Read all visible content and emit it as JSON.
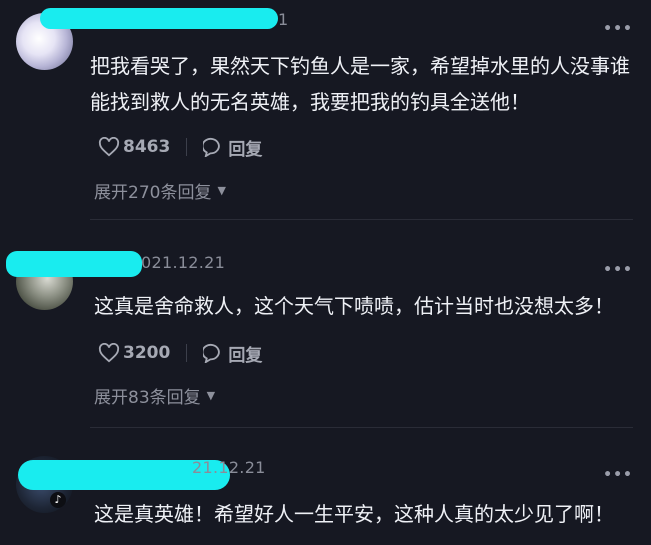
{
  "comments": [
    {
      "meta": "1",
      "more": "•••",
      "text": "把我看哭了，果然天下钓鱼人是一家，希望掉水里的人没事谁能找到救人的无名英雄，我要把我的钓具全送他！",
      "likes": "8463",
      "reply_label": "回复",
      "expand_label": "展开270条回复",
      "expand_icon": "caret-down-icon"
    },
    {
      "meta": "021.12.21",
      "more": "•••",
      "text": "这真是舍命救人，这个天气下啧啧，估计当时也没想太多！",
      "likes": "3200",
      "reply_label": "回复",
      "expand_label": "展开83条回复",
      "expand_icon": "caret-down-icon"
    },
    {
      "meta": "21.12.21",
      "more": "•••",
      "text": "这是真英雄！希望好人一生平安，这种人真的太少见了啊！",
      "badge": "♪"
    }
  ],
  "colors": {
    "background": "#161822",
    "redaction": "#19ecef",
    "text": "#eff1f6",
    "muted": "#8a8d99"
  }
}
